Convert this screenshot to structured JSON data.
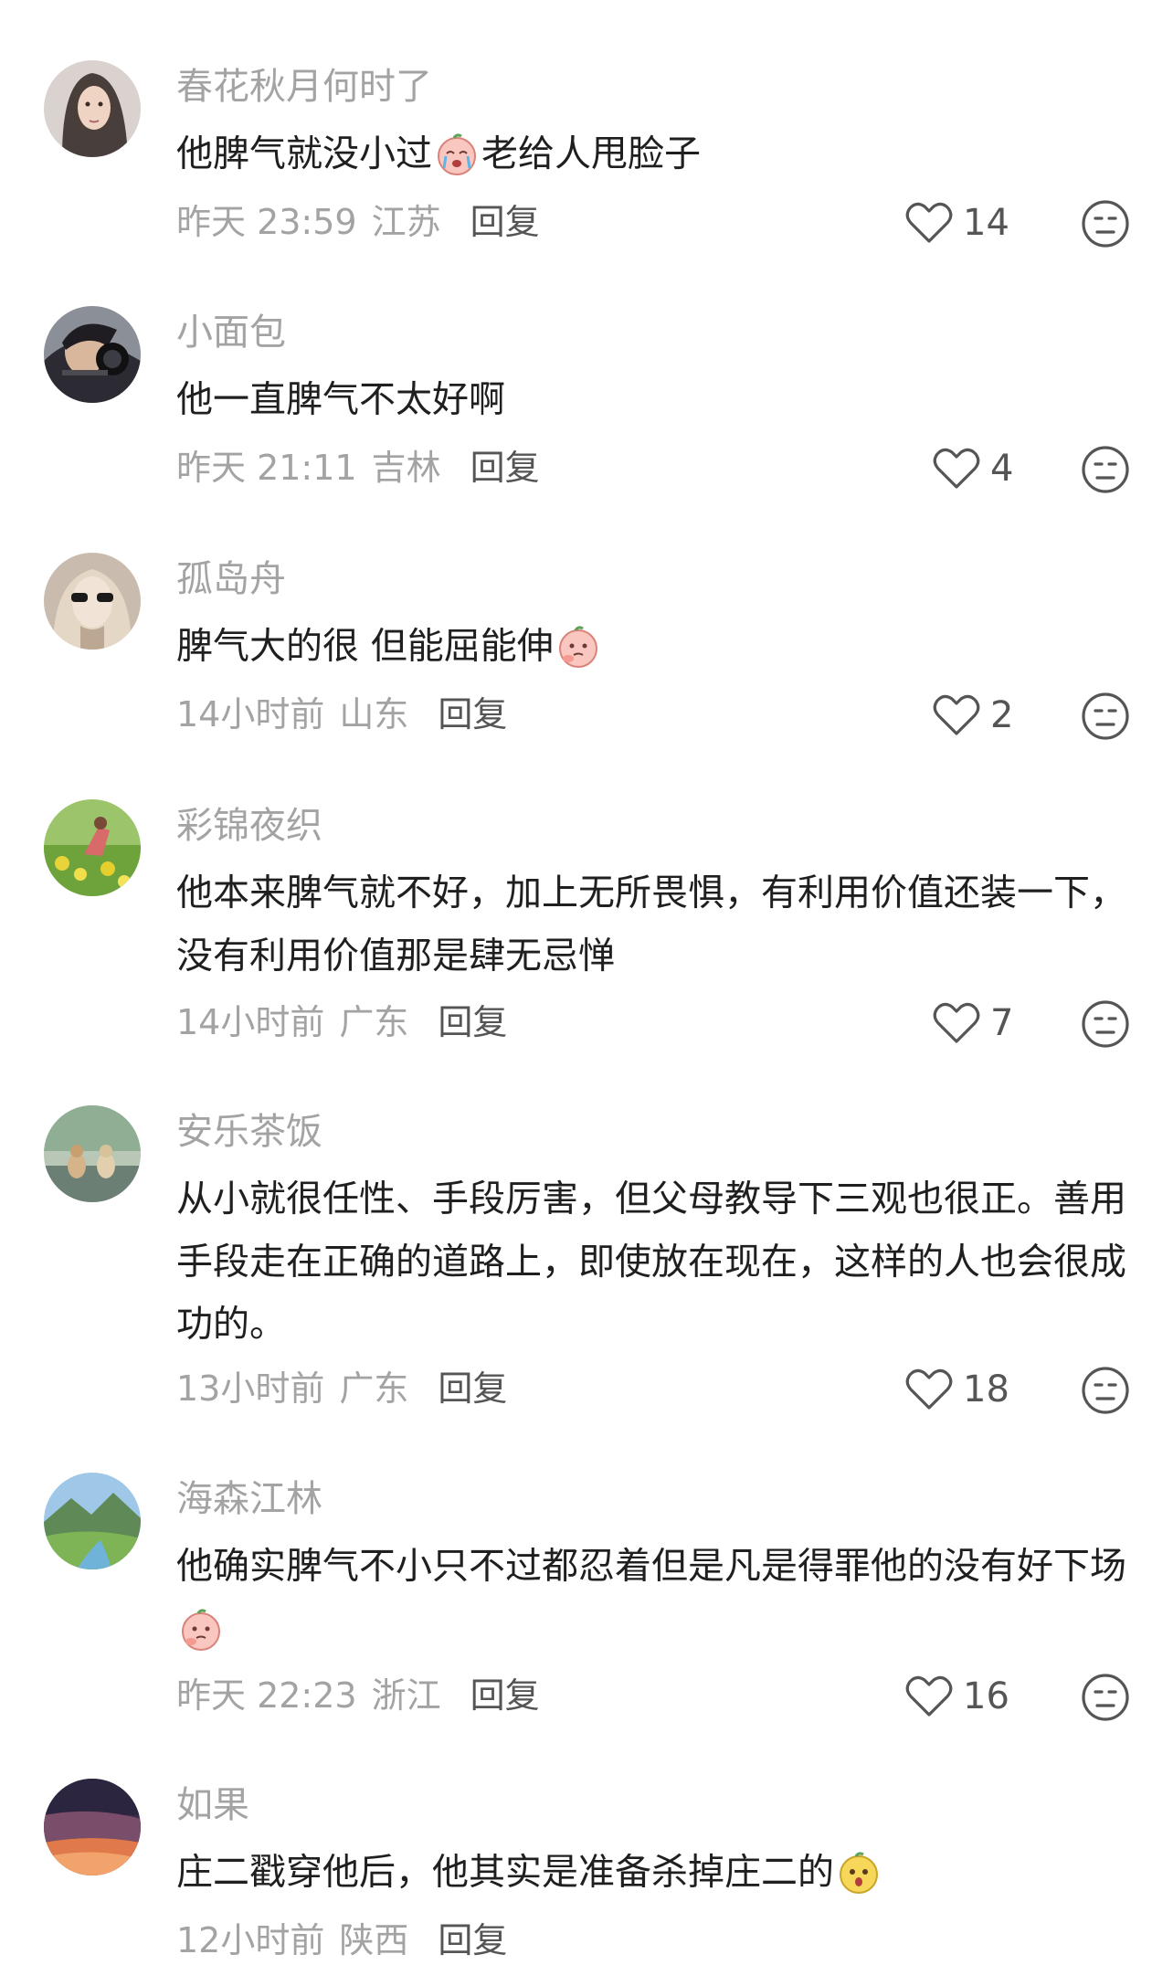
{
  "comments": [
    {
      "username": "春花秋月何时了",
      "text": [
        "他脾气就没小过",
        "老给人甩脸子"
      ],
      "emoji": [
        "crying-peach-emoji"
      ],
      "time": "昨天 23:59",
      "location": "江苏",
      "reply": "回复",
      "likes": "14"
    },
    {
      "username": "小面包",
      "text": [
        "他一直脾气不太好啊"
      ],
      "emoji": [],
      "time": "昨天 21:11",
      "location": "吉林",
      "reply": "回复",
      "likes": "4"
    },
    {
      "username": "孤岛舟",
      "text": [
        "脾气大的很 但能屈能伸",
        ""
      ],
      "emoji": [
        "thinking-peach-emoji"
      ],
      "time": "14小时前",
      "location": "山东",
      "reply": "回复",
      "likes": "2"
    },
    {
      "username": "彩锦夜织",
      "text": [
        "他本来脾气就不好，加上无所畏惧，有利用价值还装一下，没有利用价值那是肆无忌惮"
      ],
      "emoji": [],
      "time": "14小时前",
      "location": "广东",
      "reply": "回复",
      "likes": "7"
    },
    {
      "username": "安乐茶饭",
      "text": [
        "从小就很任性、手段厉害，但父母教导下三观也很正。善用手段走在正确的道路上，即使放在现在，这样的人也会很成功的。"
      ],
      "emoji": [],
      "time": "13小时前",
      "location": "广东",
      "reply": "回复",
      "likes": "18"
    },
    {
      "username": "海森江林",
      "text": [
        "他确实脾气不小只不过都忍着但是凡是得罪他的没有好下场",
        ""
      ],
      "emoji": [
        "thinking-peach-emoji"
      ],
      "time": "昨天 22:23",
      "location": "浙江",
      "reply": "回复",
      "likes": "16"
    },
    {
      "username": "如果",
      "text": [
        "庄二戳穿他后，他其实是准备杀掉庄二的",
        ""
      ],
      "emoji": [
        "shocked-yellow-emoji"
      ],
      "time": "12小时前",
      "location": "陕西",
      "reply": "回复",
      "likes": ""
    }
  ],
  "colors": {
    "username": "#a3a3a3",
    "body": "#1f1f1f",
    "meta": "#a3a3a3",
    "reply": "#555555",
    "icon": "#555555"
  }
}
